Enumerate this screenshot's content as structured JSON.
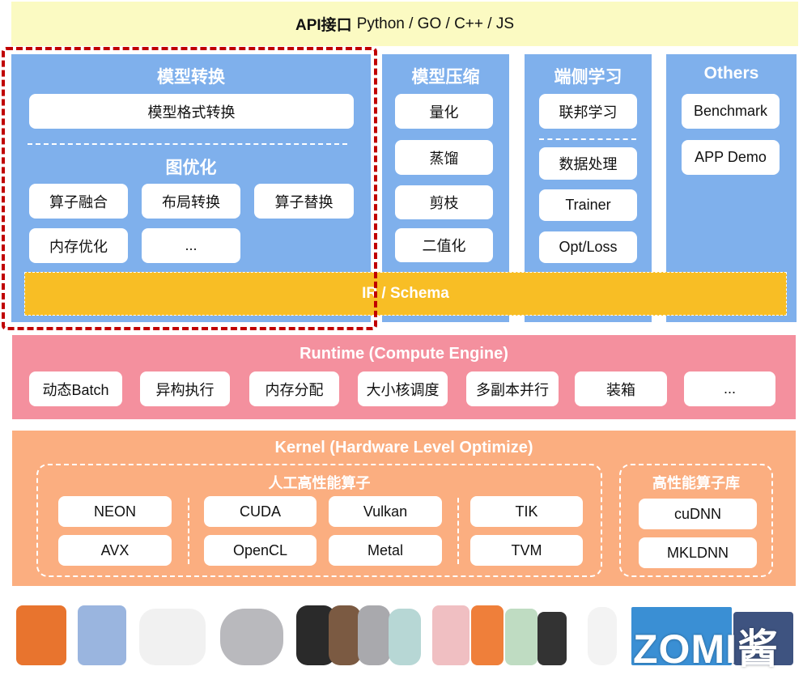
{
  "api": {
    "label": "API接口",
    "languages": "Python / GO / C++ / JS"
  },
  "columns": {
    "model_conversion": {
      "title": "模型转换",
      "format_box": "模型格式转换",
      "graph_opt_title": "图优化",
      "graph_opt_items": [
        "算子融合",
        "布局转换",
        "算子替换",
        "内存优化",
        "..."
      ]
    },
    "model_compression": {
      "title": "模型压缩",
      "items": [
        "量化",
        "蒸馏",
        "剪枝",
        "二值化"
      ]
    },
    "on_device_learning": {
      "title": "端侧学习",
      "top_item": "联邦学习",
      "items": [
        "数据处理",
        "Trainer",
        "Opt/Loss"
      ]
    },
    "others": {
      "title": "Others",
      "items": [
        "Benchmark",
        "APP Demo"
      ]
    }
  },
  "ir": {
    "label": "IR / Schema"
  },
  "runtime": {
    "title": "Runtime (Compute Engine)",
    "items": [
      "动态Batch",
      "异构执行",
      "内存分配",
      "大小核调度",
      "多副本并行",
      "装箱",
      "..."
    ]
  },
  "kernel": {
    "title": "Kernel (Hardware Level Optimize)",
    "manual": {
      "title": "人工高性能算子",
      "items": [
        "NEON",
        "AVX",
        "CUDA",
        "OpenCL",
        "Vulkan",
        "Metal",
        "TIK",
        "TVM"
      ]
    },
    "library": {
      "title": "高性能算子库",
      "items": [
        "cuDNN",
        "MKLDNN"
      ]
    }
  },
  "devices": {
    "items": [
      "phone-orange",
      "phone-blue",
      "earbuds-white",
      "earbuds-grey",
      "watch-black",
      "watch-brown",
      "watch-silver",
      "watch-mint",
      "band-pink",
      "band-orange",
      "band-green",
      "band-black",
      "camera",
      "tv",
      "tablet"
    ],
    "watermark": "ZOMI酱"
  },
  "highlight": {
    "color": "#c00000"
  }
}
